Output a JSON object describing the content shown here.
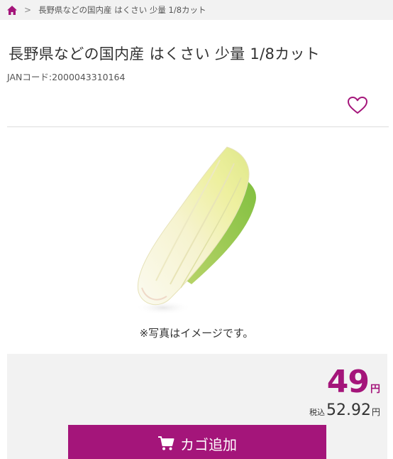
{
  "breadcrumb": {
    "home_icon": "home-icon",
    "separator": ">",
    "current": "長野県などの国内産 はくさい 少量 1/8カット"
  },
  "product": {
    "title": "長野県などの国内産 はくさい 少量 1/8カット",
    "jan": "JANコード:2000043310164",
    "favorite_icon": "heart-icon",
    "image_alt": "napa-cabbage-eighth-cut",
    "image_note": "※写真はイメージです。"
  },
  "price": {
    "value": "49",
    "currency": "円",
    "tax_label": "税込",
    "tax_value": "52.92",
    "tax_currency": "円"
  },
  "cart": {
    "icon": "cart-icon",
    "label": "カゴ追加"
  },
  "colors": {
    "accent": "#a4157a",
    "breadcrumb_bg": "#f2f2f2",
    "price_box_bg": "#f2f2f2"
  }
}
